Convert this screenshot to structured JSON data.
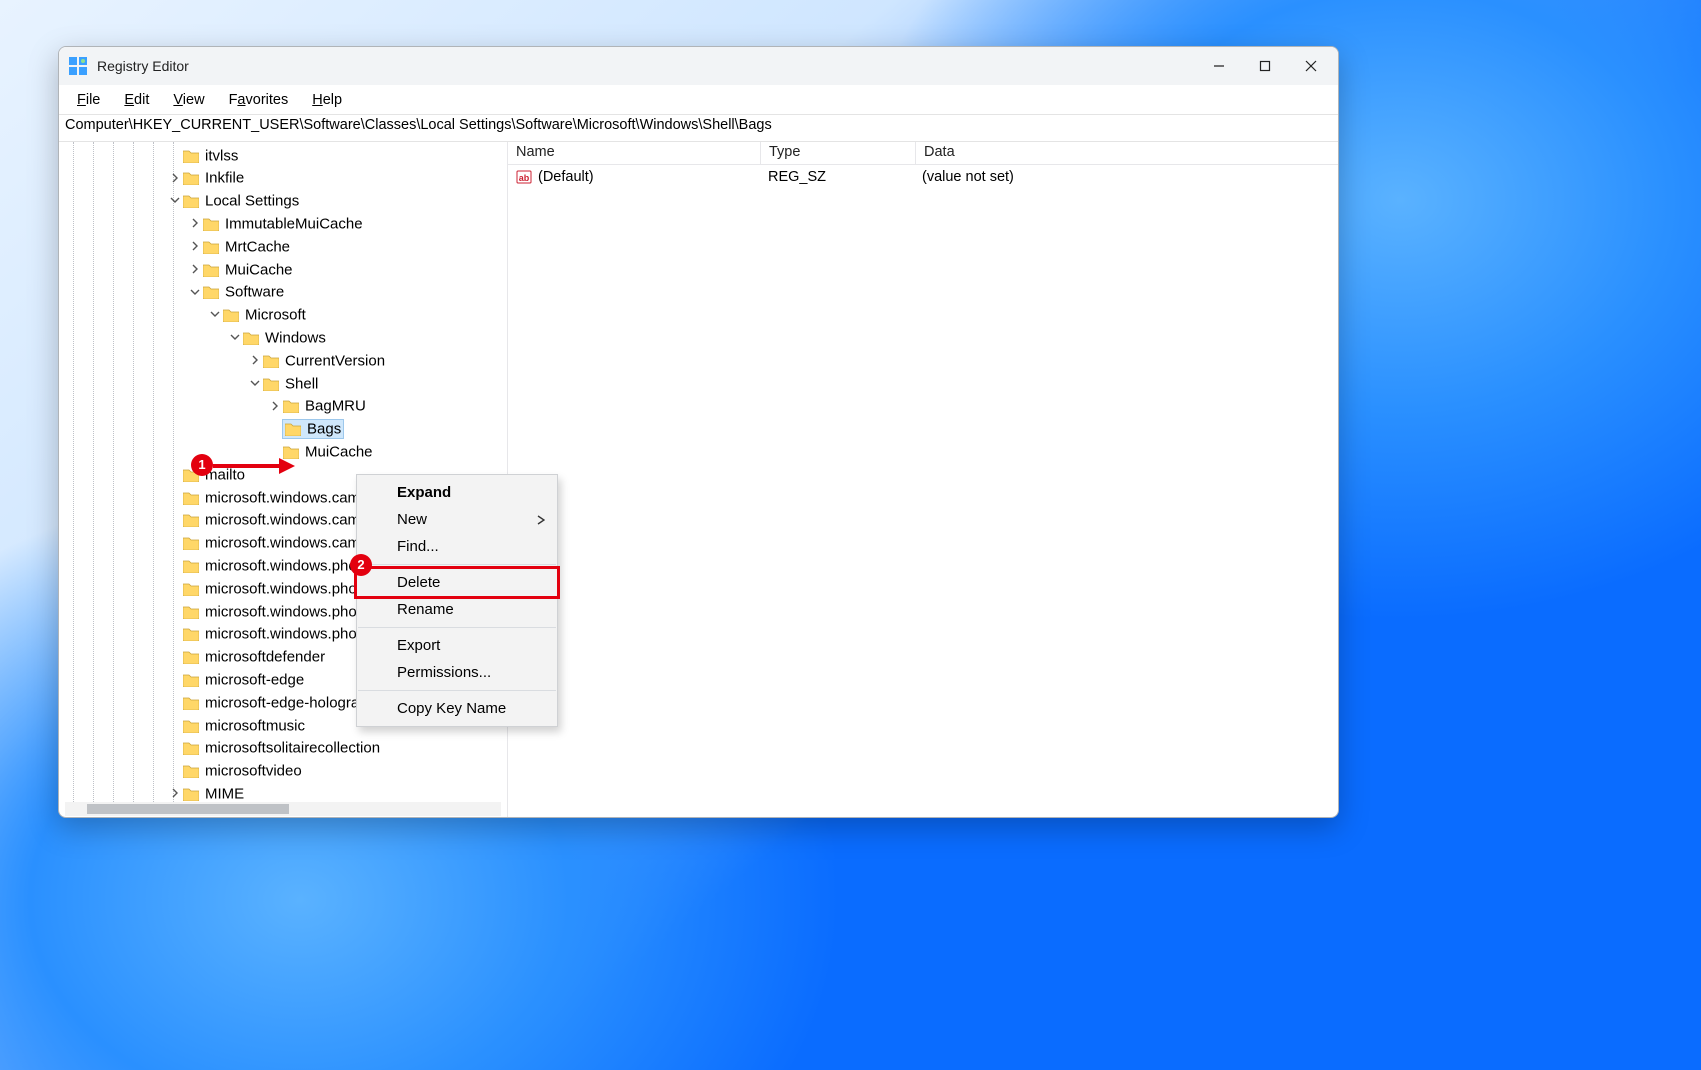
{
  "window": {
    "title": "Registry Editor",
    "menus": {
      "file": "File",
      "edit": "Edit",
      "view": "View",
      "favorites": "Favorites",
      "help": "Help"
    },
    "address": "Computer\\HKEY_CURRENT_USER\\Software\\Classes\\Local Settings\\Software\\Microsoft\\Windows\\Shell\\Bags"
  },
  "tree": {
    "nodes": [
      {
        "depth": 5,
        "exp": "none",
        "label": "itvlss"
      },
      {
        "depth": 5,
        "exp": "closed",
        "label": "Inkfile"
      },
      {
        "depth": 5,
        "exp": "open",
        "label": "Local Settings"
      },
      {
        "depth": 6,
        "exp": "closed",
        "label": "ImmutableMuiCache"
      },
      {
        "depth": 6,
        "exp": "closed",
        "label": "MrtCache"
      },
      {
        "depth": 6,
        "exp": "closed",
        "label": "MuiCache"
      },
      {
        "depth": 6,
        "exp": "open",
        "label": "Software"
      },
      {
        "depth": 7,
        "exp": "open",
        "label": "Microsoft"
      },
      {
        "depth": 8,
        "exp": "open",
        "label": "Windows"
      },
      {
        "depth": 9,
        "exp": "closed",
        "label": "CurrentVersion"
      },
      {
        "depth": 9,
        "exp": "open",
        "label": "Shell"
      },
      {
        "depth": 10,
        "exp": "closed",
        "label": "BagMRU"
      },
      {
        "depth": 10,
        "exp": "none",
        "label": "Bags",
        "selected": true
      },
      {
        "depth": 10,
        "exp": "none",
        "label": "MuiCache"
      },
      {
        "depth": 5,
        "exp": "none",
        "label": "mailto"
      },
      {
        "depth": 5,
        "exp": "none",
        "label": "microsoft.windows.camera"
      },
      {
        "depth": 5,
        "exp": "none",
        "label": "microsoft.windows.camera.multipicker"
      },
      {
        "depth": 5,
        "exp": "none",
        "label": "microsoft.windows.camera.picker"
      },
      {
        "depth": 5,
        "exp": "none",
        "label": "microsoft.windows.photos.crop"
      },
      {
        "depth": 5,
        "exp": "none",
        "label": "microsoft.windows.photos.picker"
      },
      {
        "depth": 5,
        "exp": "none",
        "label": "microsoft.windows.photos.search"
      },
      {
        "depth": 5,
        "exp": "none",
        "label": "microsoft.windows.photos.videoedit"
      },
      {
        "depth": 5,
        "exp": "none",
        "label": "microsoftdefender"
      },
      {
        "depth": 5,
        "exp": "none",
        "label": "microsoft-edge"
      },
      {
        "depth": 5,
        "exp": "none",
        "label": "microsoft-edge-holographic"
      },
      {
        "depth": 5,
        "exp": "none",
        "label": "microsoftmusic"
      },
      {
        "depth": 5,
        "exp": "none",
        "label": "microsoftsolitairecollection"
      },
      {
        "depth": 5,
        "exp": "none",
        "label": "microsoftvideo"
      },
      {
        "depth": 5,
        "exp": "closed",
        "label": "MIME"
      }
    ]
  },
  "list": {
    "headers": {
      "name": "Name",
      "type": "Type",
      "data": "Data"
    },
    "rows": [
      {
        "name": "(Default)",
        "type": "REG_SZ",
        "data": "(value not set)"
      }
    ]
  },
  "contextMenu": {
    "items": [
      {
        "label": "Expand",
        "bold": true
      },
      {
        "label": "New",
        "submenu": true
      },
      {
        "label": "Find..."
      },
      {
        "sep": true
      },
      {
        "label": "Delete",
        "highlight": true
      },
      {
        "label": "Rename"
      },
      {
        "sep": true
      },
      {
        "label": "Export"
      },
      {
        "label": "Permissions..."
      },
      {
        "sep": true
      },
      {
        "label": "Copy Key Name"
      }
    ]
  },
  "annotations": {
    "callout1": "1",
    "callout2": "2"
  }
}
